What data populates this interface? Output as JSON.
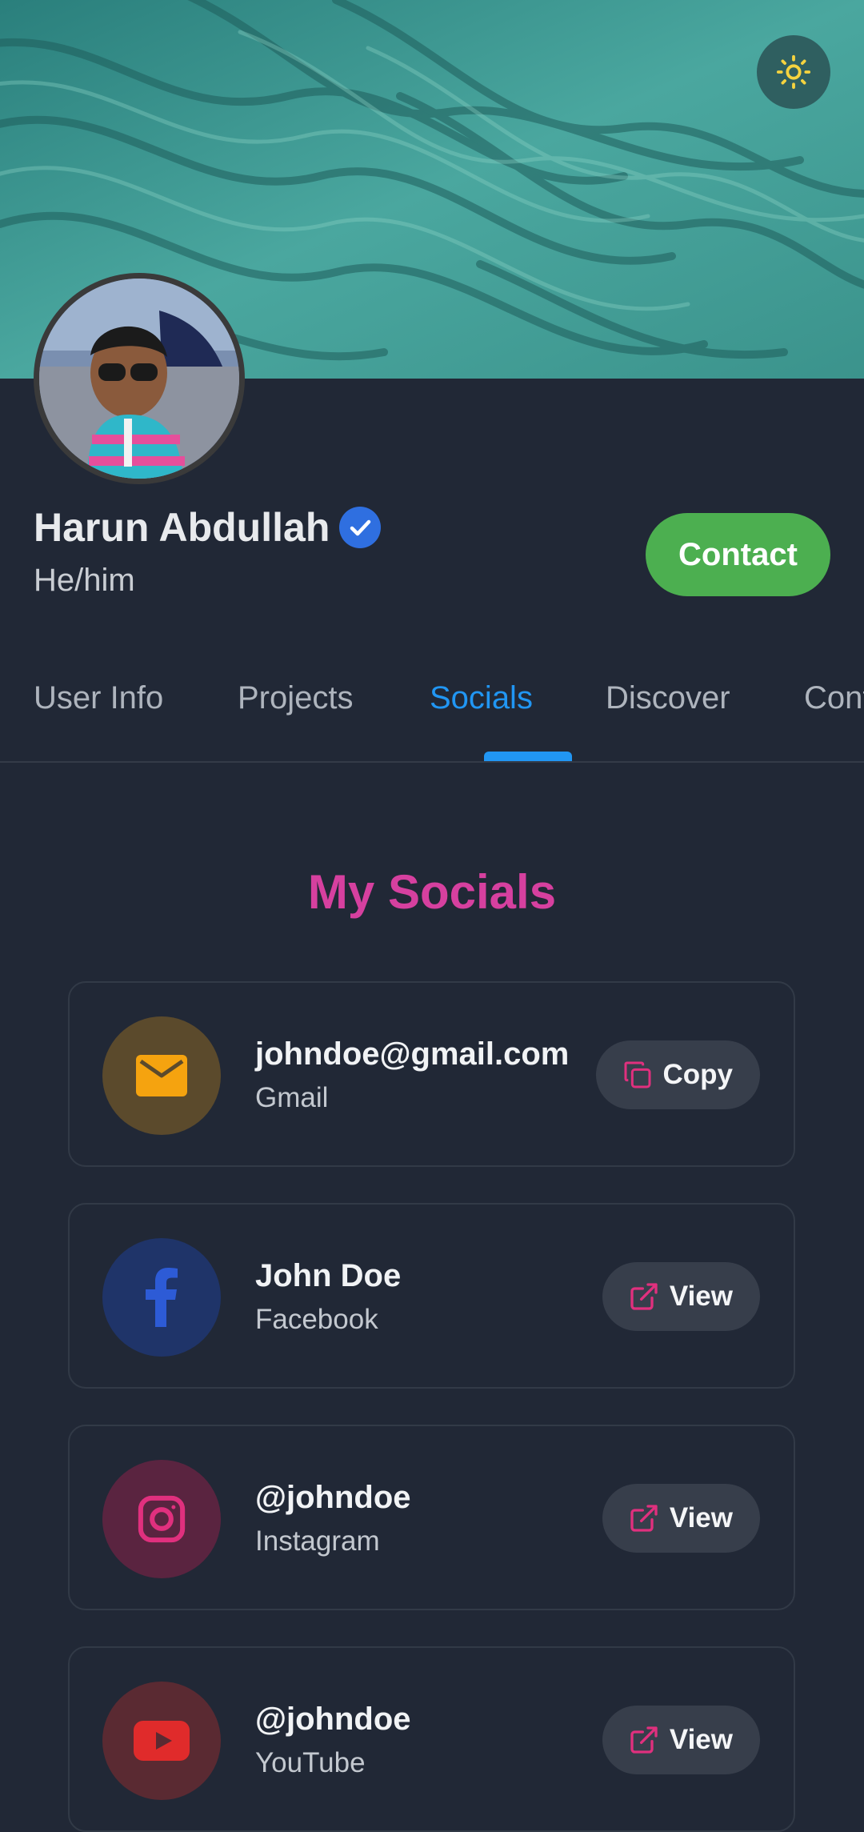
{
  "profile": {
    "name": "Harun Abdullah",
    "pronouns": "He/him",
    "contact_label": "Contact"
  },
  "tabs": [
    {
      "label": "User Info",
      "active": false
    },
    {
      "label": "Projects",
      "active": false
    },
    {
      "label": "Socials",
      "active": true
    },
    {
      "label": "Discover",
      "active": false
    },
    {
      "label": "Contact",
      "active": false
    }
  ],
  "section_title": "My Socials",
  "socials": [
    {
      "primary": "johndoe@gmail.com",
      "secondary": "Gmail",
      "action": "Copy",
      "icon": "mail-icon",
      "accent": "#f5a30f"
    },
    {
      "primary": "John Doe",
      "secondary": "Facebook",
      "action": "View",
      "icon": "facebook-icon",
      "accent": "#2d5bd6"
    },
    {
      "primary": "@johndoe",
      "secondary": "Instagram",
      "action": "View",
      "icon": "instagram-icon",
      "accent": "#e0307e"
    },
    {
      "primary": "@johndoe",
      "secondary": "YouTube",
      "action": "View",
      "icon": "youtube-icon",
      "accent": "#e02b2b"
    }
  ],
  "colors": {
    "background": "#212836",
    "active_tab": "#2196f3",
    "contact_button": "#4caf50",
    "section_title": "#d6409f"
  }
}
